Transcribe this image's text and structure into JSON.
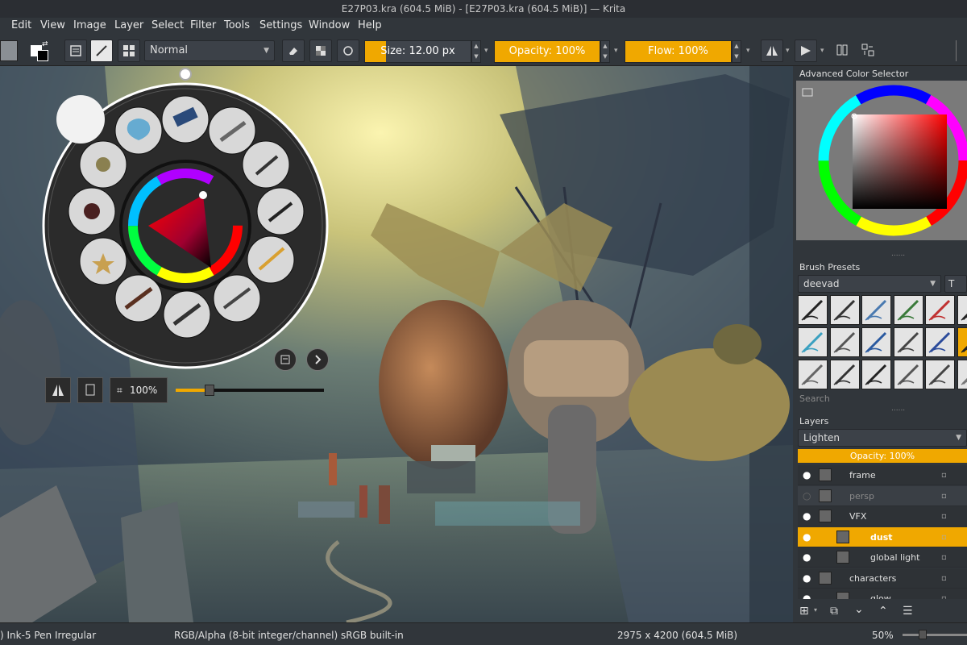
{
  "window": {
    "title": "E27P03.kra (604.5 MiB) - [E27P03.kra (604.5 MiB)] — Krita"
  },
  "menu": [
    "Edit",
    "View",
    "Image",
    "Layer",
    "Select",
    "Filter",
    "Tools",
    "Settings",
    "Window",
    "Help"
  ],
  "toolbar": {
    "blend_mode": "Normal",
    "size_label": "Size:",
    "size_value": "12.00 px",
    "size_fill": 0.2,
    "opacity_label": "Opacity:",
    "opacity_value": "100%",
    "opacity_fill": 1.0,
    "flow_label": "Flow:",
    "flow_value": "100%",
    "flow_fill": 1.0
  },
  "popup": {
    "zoom_value": "100%",
    "zoom_fraction": 0.23
  },
  "dockers": {
    "color_selector_title": "Advanced Color Selector",
    "brush_presets_title": "Brush Presets",
    "brush_tag": "deevad",
    "brush_filter_partial": "T",
    "search_placeholder": "Search",
    "layers_title": "Layers",
    "layer_blend_mode": "Lighten",
    "layer_opacity_label": "Opacity:",
    "layer_opacity_value": "100%"
  },
  "layers": [
    {
      "name": "frame",
      "visible": true,
      "selected": false,
      "indent": 0
    },
    {
      "name": "persp",
      "visible": false,
      "selected": false,
      "indent": 0
    },
    {
      "name": "VFX",
      "visible": true,
      "selected": false,
      "indent": 0
    },
    {
      "name": "dust",
      "visible": true,
      "selected": true,
      "indent": 1
    },
    {
      "name": "global light",
      "visible": true,
      "selected": false,
      "indent": 1
    },
    {
      "name": "characters",
      "visible": true,
      "selected": false,
      "indent": 0
    },
    {
      "name": "glow",
      "visible": true,
      "selected": false,
      "indent": 1
    }
  ],
  "status": {
    "brush_name": ") Ink-5 Pen Irregular",
    "color_space": "RGB/Alpha (8-bit integer/channel)  sRGB built-in",
    "image_size": "2975 x 4200 (604.5 MiB)",
    "zoom": "50%"
  },
  "colors": {
    "accent": "#f0a800",
    "bg": "#31363b",
    "selected_layer": "#f0a800"
  }
}
